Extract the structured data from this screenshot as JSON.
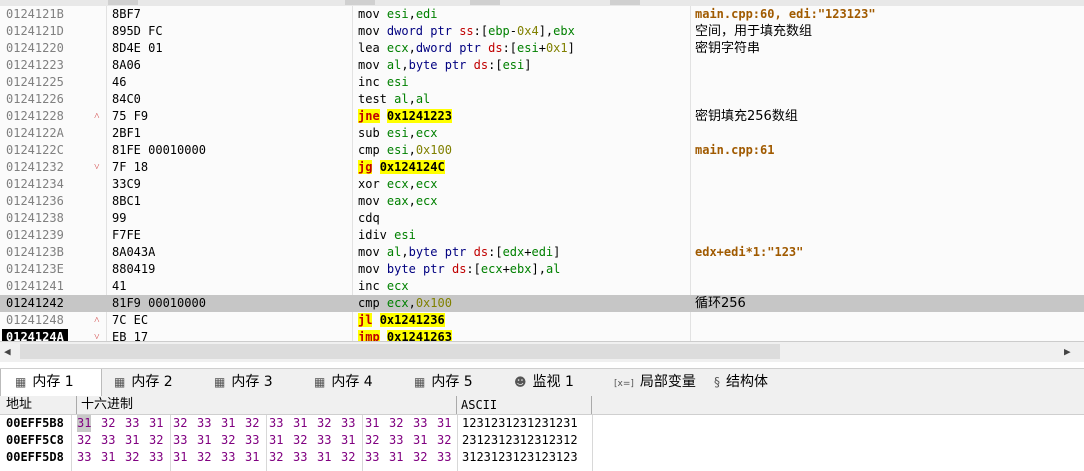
{
  "disasm": {
    "rows": [
      {
        "addr": "0124121B",
        "arrow": "",
        "bytes": "8BF7",
        "instr": "mov esi,edi",
        "comment": "main.cpp:60, edi:\"123123\"",
        "ctype": "mod"
      },
      {
        "addr": "0124121D",
        "arrow": "",
        "bytes": "895D FC",
        "instr": "mov dword ptr ss:[ebp-0x4],ebx",
        "comment": "空间，用于填充数组",
        "ctype": "zh"
      },
      {
        "addr": "01241220",
        "arrow": "",
        "bytes": "8D4E 01",
        "instr": "lea ecx,dword ptr ds:[esi+0x1]",
        "comment": "密钥字符串",
        "ctype": "zh"
      },
      {
        "addr": "01241223",
        "arrow": "",
        "bytes": "8A06",
        "instr": "mov al,byte ptr ds:[esi]",
        "comment": "",
        "ctype": ""
      },
      {
        "addr": "01241225",
        "arrow": "",
        "bytes": "46",
        "instr": "inc esi",
        "comment": "",
        "ctype": ""
      },
      {
        "addr": "01241226",
        "arrow": "",
        "bytes": "84C0",
        "instr": "test al,al",
        "comment": "",
        "ctype": ""
      },
      {
        "addr": "01241228",
        "arrow": "^",
        "bytes": "75 F9",
        "instr": "jne 0x1241223",
        "comment": "密钥填充256数组",
        "ctype": "zh"
      },
      {
        "addr": "0124122A",
        "arrow": "",
        "bytes": "2BF1",
        "instr": "sub esi,ecx",
        "comment": "",
        "ctype": ""
      },
      {
        "addr": "0124122C",
        "arrow": "",
        "bytes": "81FE 00010000",
        "instr": "cmp esi,0x100",
        "comment": "main.cpp:61",
        "ctype": "mod"
      },
      {
        "addr": "01241232",
        "arrow": "v",
        "bytes": "7F 18",
        "instr": "jg 0x124124C",
        "comment": "",
        "ctype": ""
      },
      {
        "addr": "01241234",
        "arrow": "",
        "bytes": "33C9",
        "instr": "xor ecx,ecx",
        "comment": "",
        "ctype": ""
      },
      {
        "addr": "01241236",
        "arrow": "",
        "bytes": "8BC1",
        "instr": "mov eax,ecx",
        "comment": "",
        "ctype": ""
      },
      {
        "addr": "01241238",
        "arrow": "",
        "bytes": "99",
        "instr": "cdq",
        "comment": "",
        "ctype": ""
      },
      {
        "addr": "01241239",
        "arrow": "",
        "bytes": "F7FE",
        "instr": "idiv esi",
        "comment": "",
        "ctype": ""
      },
      {
        "addr": "0124123B",
        "arrow": "",
        "bytes": "8A043A",
        "instr": "mov al,byte ptr ds:[edx+edi]",
        "comment": "edx+edi*1:\"123\"",
        "ctype": "mod"
      },
      {
        "addr": "0124123E",
        "arrow": "",
        "bytes": "880419",
        "instr": "mov byte ptr ds:[ecx+ebx],al",
        "comment": "",
        "ctype": ""
      },
      {
        "addr": "01241241",
        "arrow": "",
        "bytes": "41",
        "instr": "inc ecx",
        "comment": "",
        "ctype": ""
      },
      {
        "addr": "01241242",
        "arrow": "",
        "bytes": "81F9 00010000",
        "instr": "cmp ecx,0x100",
        "comment": "循环256",
        "ctype": "zh",
        "highlight": true
      },
      {
        "addr": "01241248",
        "arrow": "^",
        "bytes": "7C EC",
        "instr": "jl 0x1241236",
        "comment": "",
        "ctype": ""
      },
      {
        "addr": "0124124A",
        "arrow": "v",
        "bytes": "EB 17",
        "instr": "jmp 0x1241263",
        "comment": "",
        "ctype": "",
        "current": true
      }
    ]
  },
  "tabs": [
    {
      "icon": "memory-icon",
      "label": "内存 1",
      "active": true
    },
    {
      "icon": "memory-icon",
      "label": "内存 2"
    },
    {
      "icon": "memory-icon",
      "label": "内存 3"
    },
    {
      "icon": "memory-icon",
      "label": "内存 4"
    },
    {
      "icon": "memory-icon",
      "label": "内存 5"
    },
    {
      "icon": "watch-icon",
      "label": "监视 1"
    },
    {
      "icon": "locals-icon",
      "label": "局部变量",
      "icon_text": "[x=]"
    },
    {
      "icon": "struct-icon",
      "label": "结构体"
    }
  ],
  "memory": {
    "headers": {
      "address": "地址",
      "hex": "十六进制",
      "ascii": "ASCII"
    },
    "rows": [
      {
        "addr": "00EFF5B8",
        "hex": [
          "31",
          "32",
          "33",
          "31",
          "32",
          "33",
          "31",
          "32",
          "33",
          "31",
          "32",
          "33",
          "31",
          "32",
          "33",
          "31"
        ],
        "ascii": "1231231231231231"
      },
      {
        "addr": "00EFF5C8",
        "hex": [
          "32",
          "33",
          "31",
          "32",
          "33",
          "31",
          "32",
          "33",
          "31",
          "32",
          "33",
          "31",
          "32",
          "33",
          "31",
          "32"
        ],
        "ascii": "2312312312312312"
      },
      {
        "addr": "00EFF5D8",
        "hex": [
          "33",
          "31",
          "32",
          "33",
          "31",
          "32",
          "33",
          "31",
          "32",
          "33",
          "31",
          "32",
          "33",
          "31",
          "32",
          "33"
        ],
        "ascii": "3123123123123123"
      }
    ]
  },
  "colors": {
    "highlight_row": "#c6c6c6",
    "jump_bg": "#ffff00",
    "register": "#008000",
    "segment": "#c00000",
    "number": "#808000",
    "comment_module": "#a05a00",
    "hex_bytes": "#800080"
  }
}
